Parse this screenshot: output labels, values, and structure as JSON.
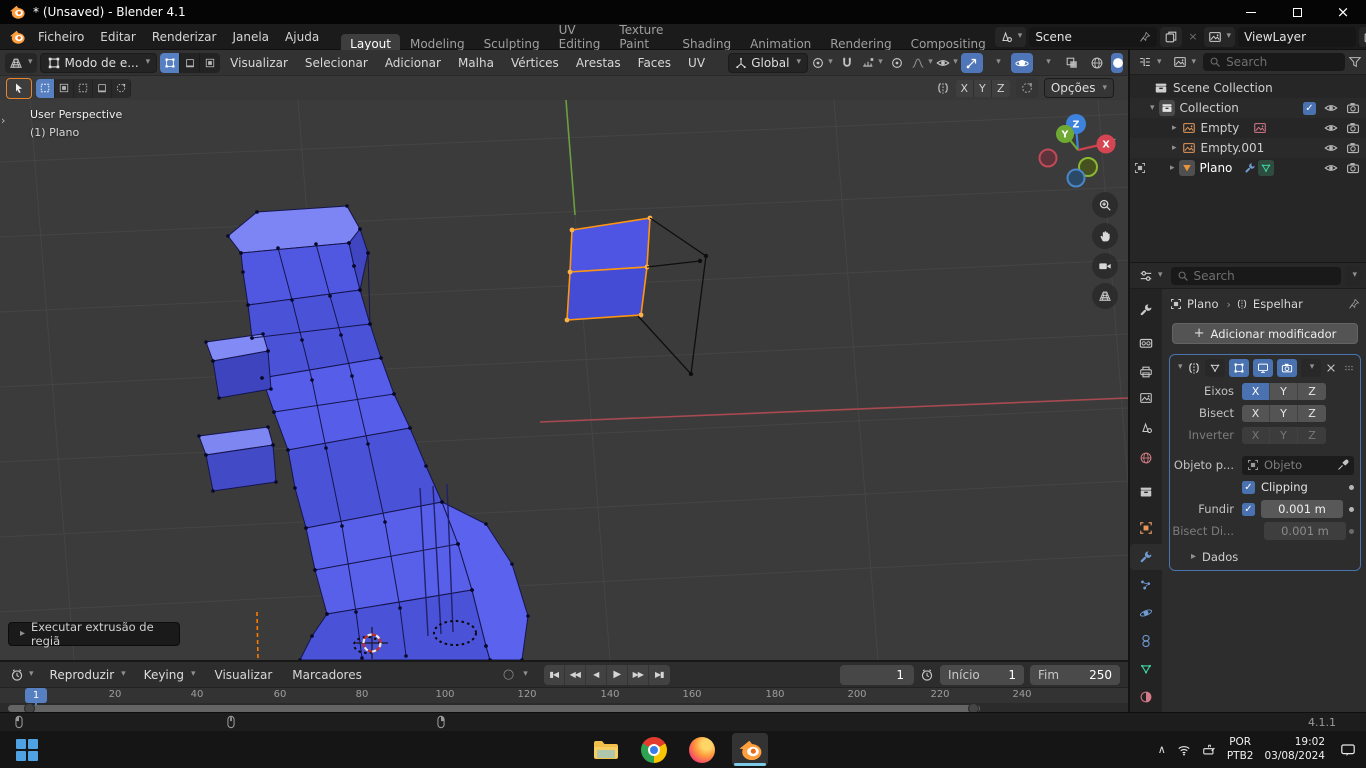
{
  "titlebar": {
    "title": "* (Unsaved) - Blender 4.1"
  },
  "menubar": {
    "items": [
      "Ficheiro",
      "Editar",
      "Renderizar",
      "Janela",
      "Ajuda"
    ]
  },
  "workspace_tabs": {
    "items": [
      "Layout",
      "Modeling",
      "Sculpting",
      "UV Editing",
      "Texture Paint",
      "Shading",
      "Animation",
      "Rendering",
      "Compositing"
    ]
  },
  "scene": {
    "name": "Scene"
  },
  "view_layer": {
    "name": "ViewLayer"
  },
  "viewport": {
    "mode": "Modo de e...",
    "menus": [
      "Visualizar",
      "Selecionar",
      "Adicionar",
      "Malha",
      "Vértices",
      "Arestas",
      "Faces",
      "UV"
    ],
    "orientation": "Global",
    "options": "Opções",
    "overlay": {
      "perspective": "User Perspective",
      "object": "(1) Plano"
    },
    "operator": "Executar extrusão de regiã",
    "gizmo": {
      "x": "X",
      "y": "Y",
      "z": "Z"
    }
  },
  "outliner": {
    "search_placeholder": "Search",
    "scene_collection": "Scene Collection",
    "rows": [
      {
        "label": "Collection"
      },
      {
        "label": "Empty"
      },
      {
        "label": "Empty.001"
      },
      {
        "label": "Plano"
      }
    ]
  },
  "properties": {
    "search_placeholder": "Search",
    "breadcrumb": {
      "object": "Plano",
      "modifier": "Espelhar"
    },
    "add_button": "Adicionar modificador",
    "modifier": {
      "axis_label": "Eixos",
      "bisect_label": "Bisect",
      "flip_label": "Inverter",
      "axes": [
        "X",
        "Y",
        "Z"
      ],
      "mirror_object_label": "Objeto p...",
      "mirror_object_placeholder": "Objeto",
      "clipping_label": "Clipping",
      "merge_label": "Fundir",
      "merge_value": "0.001 m",
      "bisect_distance_label": "Bisect Di...",
      "bisect_distance_value": "0.001 m",
      "data_section": "Dados"
    }
  },
  "timeline": {
    "menus": [
      "Reproduzir",
      "Keying",
      "Visualizar",
      "Marcadores"
    ],
    "current_frame": "1",
    "playhead_frame": "1",
    "start_label": "Início",
    "start_value": "1",
    "end_label": "Fim",
    "end_value": "250",
    "ticks": [
      "20",
      "40",
      "60",
      "80",
      "100",
      "120",
      "140",
      "160",
      "180",
      "200",
      "220",
      "240"
    ]
  },
  "statusbar": {
    "version": "4.1.1"
  },
  "taskbar": {
    "lang_primary": "POR",
    "lang_secondary": "PTB2",
    "time": "19:02",
    "date": "03/08/2024"
  },
  "icons": {
    "chevron_down": "▾",
    "chevron_right": "▸",
    "breadcrumb_sep": "›",
    "toolbar_expand": "›",
    "npanel_collapse": "‹",
    "check": "✓",
    "close": "×",
    "autokey": "○",
    "chevron_up": "∧",
    "plus": "+",
    "playback": [
      "▮◀",
      "◀◀",
      "◀",
      "▶",
      "▶▶",
      "▶▮"
    ]
  }
}
